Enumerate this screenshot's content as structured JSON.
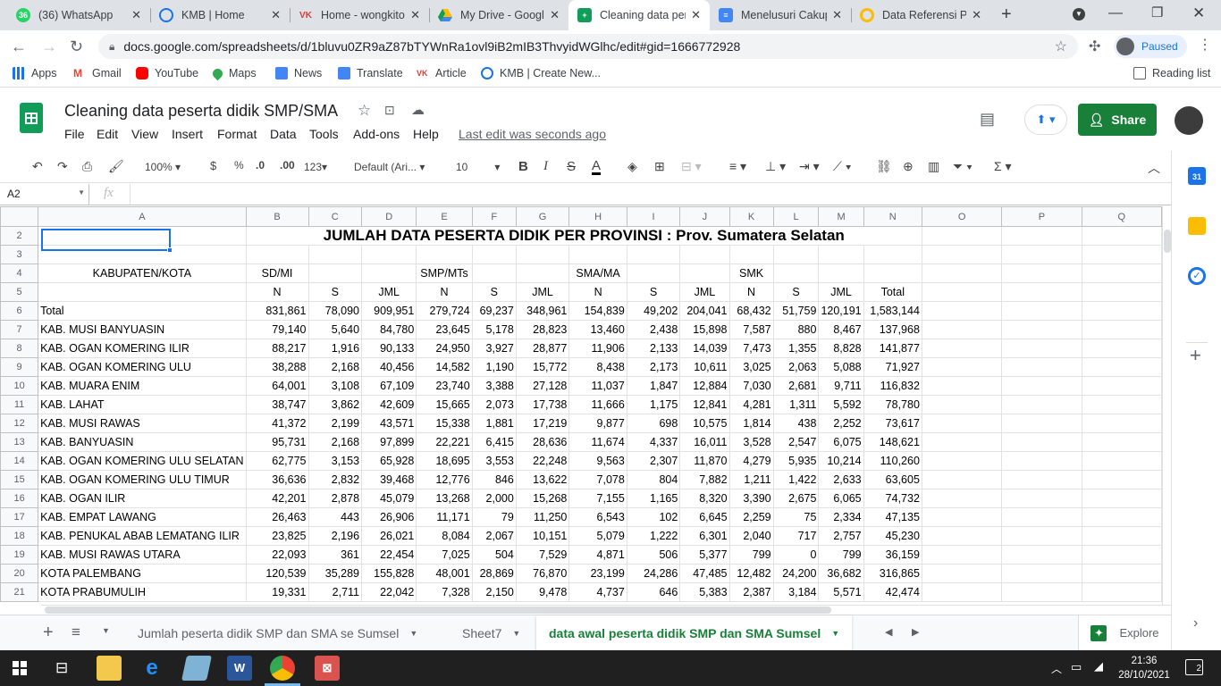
{
  "tabs": [
    {
      "label": "(36) WhatsApp",
      "badge": "36",
      "color": "#25d366"
    },
    {
      "label": "KMB | Home",
      "color": "#1a73e8"
    },
    {
      "label": "Home - wongkito",
      "color": "#e53935"
    },
    {
      "label": "My Drive - Google",
      "color": "#fbbc04"
    },
    {
      "label": "Cleaning data per",
      "color": "#0f9d58"
    },
    {
      "label": "Menelusuri Cakup",
      "color": "#4285f4"
    },
    {
      "label": "Data Referensi Pe",
      "color": "#fbbc04"
    }
  ],
  "address": {
    "url": "docs.google.com/spreadsheets/d/1bluvu0ZR9aZ87bTYWnRa1ovl9iB2mIB3ThvyidWGlhc/edit#gid=1666772928",
    "profile_status": "Paused"
  },
  "bookmarks": [
    "Apps",
    "Gmail",
    "YouTube",
    "Maps",
    "News",
    "Translate",
    "Article",
    "KMB | Create New...",
    "Reading list"
  ],
  "sheet": {
    "title": "Cleaning data peserta didik SMP/SMA",
    "menu": [
      "File",
      "Edit",
      "View",
      "Insert",
      "Format",
      "Data",
      "Tools",
      "Add-ons",
      "Help"
    ],
    "last_edit": "Last edit was seconds ago",
    "share": "Share"
  },
  "toolbar": {
    "zoom": "100%",
    "currency": "$",
    "percent": "%",
    "dec_less": ".0",
    "dec_more": ".00",
    "format123": "123",
    "font": "Default (Ari...",
    "size": "10"
  },
  "formula": {
    "cell_ref": "A2",
    "fx": "fx"
  },
  "columns": [
    "A",
    "B",
    "C",
    "D",
    "E",
    "F",
    "G",
    "H",
    "I",
    "J",
    "K",
    "L",
    "M",
    "N",
    "O",
    "P",
    "Q"
  ],
  "grid": {
    "title": "JUMLAH DATA PESERTA DIDIK PER PROVINSI : Prov. Sumatera Selatan",
    "row4": [
      "KABUPATEN/KOTA",
      "SD/MI",
      "",
      "",
      "SMP/MTs",
      "",
      "",
      "SMA/MA",
      "",
      "",
      "SMK",
      "",
      "",
      ""
    ],
    "row5": [
      "",
      "N",
      "S",
      "JML",
      "N",
      "S",
      "JML",
      "N",
      "S",
      "JML",
      "N",
      "S",
      "JML",
      "Total"
    ],
    "data": [
      [
        "Total",
        "831,861",
        "78,090",
        "909,951",
        "279,724",
        "69,237",
        "348,961",
        "154,839",
        "49,202",
        "204,041",
        "68,432",
        "51,759",
        "120,191",
        "1,583,144"
      ],
      [
        "KAB. MUSI BANYUASIN",
        "79,140",
        "5,640",
        "84,780",
        "23,645",
        "5,178",
        "28,823",
        "13,460",
        "2,438",
        "15,898",
        "7,587",
        "880",
        "8,467",
        "137,968"
      ],
      [
        "KAB. OGAN KOMERING ILIR",
        "88,217",
        "1,916",
        "90,133",
        "24,950",
        "3,927",
        "28,877",
        "11,906",
        "2,133",
        "14,039",
        "7,473",
        "1,355",
        "8,828",
        "141,877"
      ],
      [
        "KAB. OGAN KOMERING ULU",
        "38,288",
        "2,168",
        "40,456",
        "14,582",
        "1,190",
        "15,772",
        "8,438",
        "2,173",
        "10,611",
        "3,025",
        "2,063",
        "5,088",
        "71,927"
      ],
      [
        "KAB. MUARA ENIM",
        "64,001",
        "3,108",
        "67,109",
        "23,740",
        "3,388",
        "27,128",
        "11,037",
        "1,847",
        "12,884",
        "7,030",
        "2,681",
        "9,711",
        "116,832"
      ],
      [
        "KAB. LAHAT",
        "38,747",
        "3,862",
        "42,609",
        "15,665",
        "2,073",
        "17,738",
        "11,666",
        "1,175",
        "12,841",
        "4,281",
        "1,311",
        "5,592",
        "78,780"
      ],
      [
        "KAB. MUSI RAWAS",
        "41,372",
        "2,199",
        "43,571",
        "15,338",
        "1,881",
        "17,219",
        "9,877",
        "698",
        "10,575",
        "1,814",
        "438",
        "2,252",
        "73,617"
      ],
      [
        "KAB. BANYUASIN",
        "95,731",
        "2,168",
        "97,899",
        "22,221",
        "6,415",
        "28,636",
        "11,674",
        "4,337",
        "16,011",
        "3,528",
        "2,547",
        "6,075",
        "148,621"
      ],
      [
        "KAB. OGAN KOMERING ULU SELATAN",
        "62,775",
        "3,153",
        "65,928",
        "18,695",
        "3,553",
        "22,248",
        "9,563",
        "2,307",
        "11,870",
        "4,279",
        "5,935",
        "10,214",
        "110,260"
      ],
      [
        "KAB. OGAN KOMERING ULU TIMUR",
        "36,636",
        "2,832",
        "39,468",
        "12,776",
        "846",
        "13,622",
        "7,078",
        "804",
        "7,882",
        "1,211",
        "1,422",
        "2,633",
        "63,605"
      ],
      [
        "KAB. OGAN ILIR",
        "42,201",
        "2,878",
        "45,079",
        "13,268",
        "2,000",
        "15,268",
        "7,155",
        "1,165",
        "8,320",
        "3,390",
        "2,675",
        "6,065",
        "74,732"
      ],
      [
        "KAB. EMPAT LAWANG",
        "26,463",
        "443",
        "26,906",
        "11,171",
        "79",
        "11,250",
        "6,543",
        "102",
        "6,645",
        "2,259",
        "75",
        "2,334",
        "47,135"
      ],
      [
        "KAB. PENUKAL ABAB LEMATANG ILIR",
        "23,825",
        "2,196",
        "26,021",
        "8,084",
        "2,067",
        "10,151",
        "5,079",
        "1,222",
        "6,301",
        "2,040",
        "717",
        "2,757",
        "45,230"
      ],
      [
        "KAB. MUSI RAWAS UTARA",
        "22,093",
        "361",
        "22,454",
        "7,025",
        "504",
        "7,529",
        "4,871",
        "506",
        "5,377",
        "799",
        "0",
        "799",
        "36,159"
      ],
      [
        "KOTA PALEMBANG",
        "120,539",
        "35,289",
        "155,828",
        "48,001",
        "28,869",
        "76,870",
        "23,199",
        "24,286",
        "47,485",
        "12,482",
        "24,200",
        "36,682",
        "316,865"
      ],
      [
        "KOTA PRABUMULIH",
        "19,331",
        "2,711",
        "22,042",
        "7,328",
        "2,150",
        "9,478",
        "4,737",
        "646",
        "5,383",
        "2,387",
        "3,184",
        "5,571",
        "42,474"
      ]
    ]
  },
  "sheet_tabs": [
    "Jumlah peserta didik SMP dan SMA se Sumsel",
    "Sheet7",
    "data awal peserta didik SMP dan SMA Sumsel"
  ],
  "explore": "Explore",
  "clock": {
    "time": "21:36",
    "date": "28/10/2021"
  },
  "notif_count": "2"
}
